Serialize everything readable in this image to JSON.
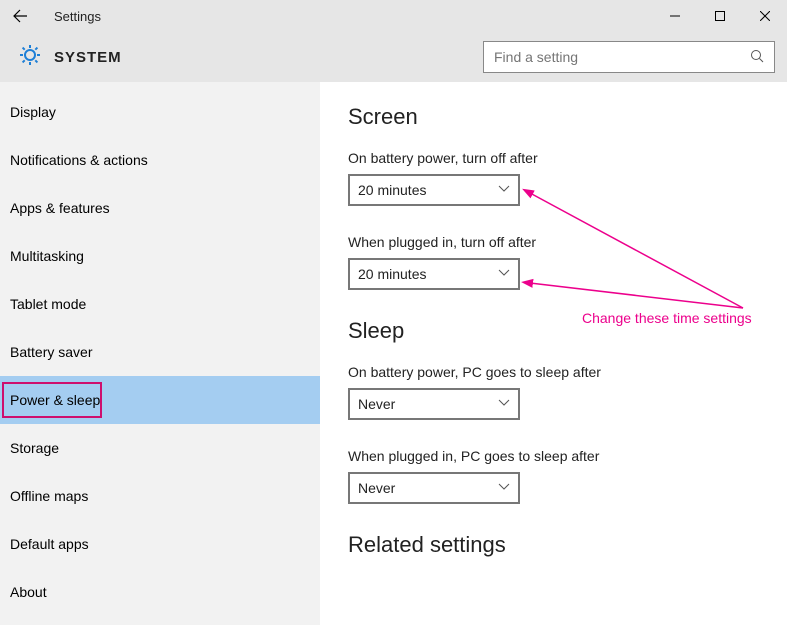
{
  "window": {
    "title": "Settings",
    "system_label": "SYSTEM",
    "search_placeholder": "Find a setting"
  },
  "sidebar": {
    "items": [
      {
        "label": "Display"
      },
      {
        "label": "Notifications & actions"
      },
      {
        "label": "Apps & features"
      },
      {
        "label": "Multitasking"
      },
      {
        "label": "Tablet mode"
      },
      {
        "label": "Battery saver"
      },
      {
        "label": "Power & sleep"
      },
      {
        "label": "Storage"
      },
      {
        "label": "Offline maps"
      },
      {
        "label": "Default apps"
      },
      {
        "label": "About"
      }
    ],
    "selected_index": 6
  },
  "main": {
    "screen": {
      "heading": "Screen",
      "battery_label": "On battery power, turn off after",
      "battery_value": "20 minutes",
      "plugged_label": "When plugged in, turn off after",
      "plugged_value": "20 minutes"
    },
    "sleep": {
      "heading": "Sleep",
      "battery_label": "On battery power, PC goes to sleep after",
      "battery_value": "Never",
      "plugged_label": "When plugged in, PC goes to sleep after",
      "plugged_value": "Never"
    },
    "related_heading": "Related settings"
  },
  "annotation": {
    "text": "Change these time settings"
  }
}
